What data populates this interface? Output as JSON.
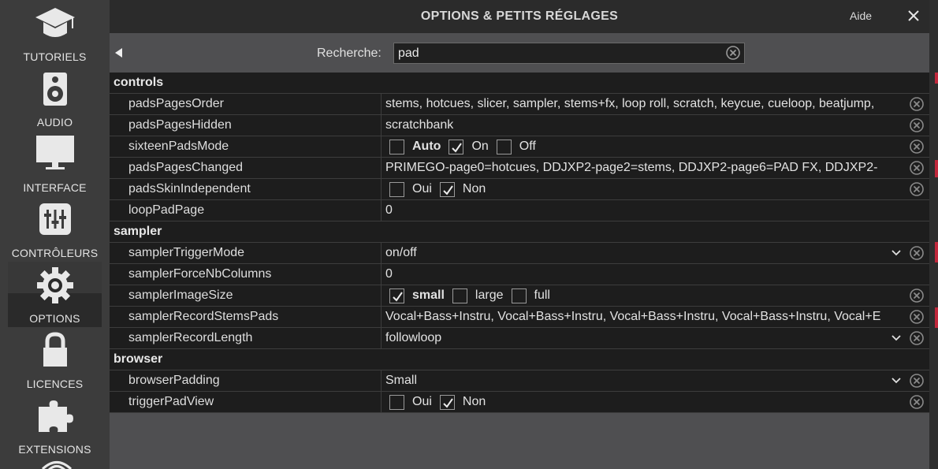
{
  "sidebar": {
    "items": [
      {
        "label": "TUTORIELS",
        "icon": "graduation-cap-icon"
      },
      {
        "label": "AUDIO",
        "icon": "speaker-icon"
      },
      {
        "label": "INTERFACE",
        "icon": "monitor-icon"
      },
      {
        "label": "CONTRÔLEURS",
        "icon": "sliders-icon"
      },
      {
        "label": "OPTIONS",
        "icon": "gear-icon",
        "active": true
      },
      {
        "label": "LICENCES",
        "icon": "lock-icon"
      },
      {
        "label": "EXTENSIONS",
        "icon": "puzzle-icon"
      }
    ]
  },
  "header": {
    "title": "OPTIONS & PETITS RÉGLAGES",
    "help_label": "Aide",
    "close_icon": "close-icon"
  },
  "search": {
    "label": "Recherche:",
    "value": "pad"
  },
  "sections": {
    "controls": {
      "title": "controls",
      "rows": {
        "padsPagesOrder": {
          "name": "padsPagesOrder",
          "value": "stems, hotcues, slicer, sampler, stems+fx, loop roll, scratch, keycue, cueloop, beatjump, "
        },
        "padsPagesHidden": {
          "name": "padsPagesHidden",
          "value": "scratchbank"
        },
        "sixteenPadsMode": {
          "name": "sixteenPadsMode",
          "options": [
            {
              "label": "Auto",
              "checked": false,
              "bold": true
            },
            {
              "label": "On",
              "checked": true,
              "bold": false
            },
            {
              "label": "Off",
              "checked": false,
              "bold": false
            }
          ]
        },
        "padsPagesChanged": {
          "name": "padsPagesChanged",
          "value": "PRIMEGO-page0=hotcues, DDJXP2-page2=stems, DDJXP2-page6=PAD FX, DDJXP2-"
        },
        "padsSkinIndependent": {
          "name": "padsSkinIndependent",
          "options": [
            {
              "label": "Oui",
              "checked": false,
              "bold": false
            },
            {
              "label": "Non",
              "checked": true,
              "bold": false
            }
          ]
        },
        "loopPadPage": {
          "name": "loopPadPage",
          "value": "0"
        }
      }
    },
    "sampler": {
      "title": "sampler",
      "rows": {
        "samplerTriggerMode": {
          "name": "samplerTriggerMode",
          "value": "on/off"
        },
        "samplerForceNbColumns": {
          "name": "samplerForceNbColumns",
          "value": "0"
        },
        "samplerImageSize": {
          "name": "samplerImageSize",
          "options": [
            {
              "label": "small",
              "checked": true,
              "bold": true
            },
            {
              "label": "large",
              "checked": false,
              "bold": false
            },
            {
              "label": "full",
              "checked": false,
              "bold": false
            }
          ]
        },
        "samplerRecordStemsPads": {
          "name": "samplerRecordStemsPads",
          "value": "Vocal+Bass+Instru, Vocal+Bass+Instru, Vocal+Bass+Instru, Vocal+Bass+Instru, Vocal+E"
        },
        "samplerRecordLength": {
          "name": "samplerRecordLength",
          "value": "followloop"
        }
      }
    },
    "browser": {
      "title": "browser",
      "rows": {
        "browserPadding": {
          "name": "browserPadding",
          "value": "Small"
        },
        "triggerPadView": {
          "name": "triggerPadView",
          "options": [
            {
              "label": "Oui",
              "checked": false,
              "bold": false
            },
            {
              "label": "Non",
              "checked": true,
              "bold": false
            }
          ]
        }
      }
    }
  },
  "colors": {
    "sidebar_bg": "#3c3c3c",
    "panel_bg": "#4f4f51",
    "row_bg": "#1d1d1d",
    "accent_red": "#c0283c"
  }
}
